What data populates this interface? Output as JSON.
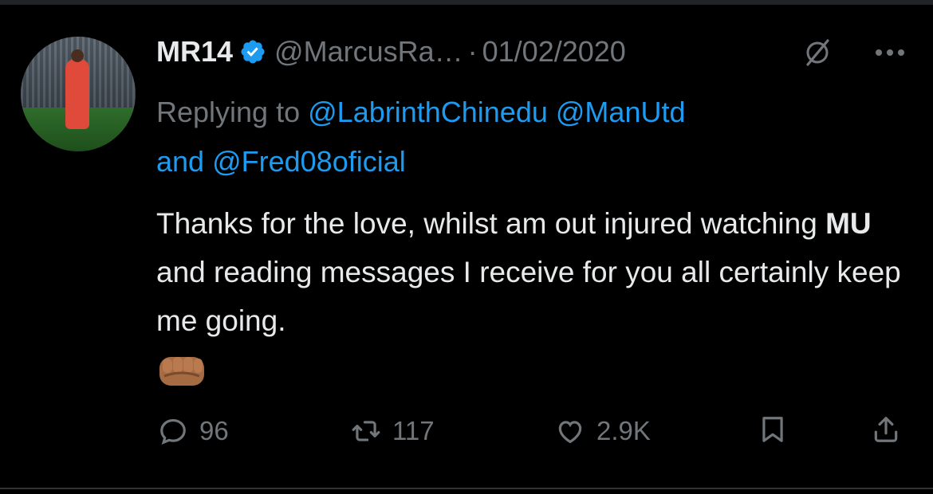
{
  "tweet": {
    "author_name": "MR14",
    "handle": "@MarcusRa…",
    "separator": "·",
    "date": "01/02/2020",
    "replying_prefix": "Replying to",
    "mentions": [
      "@LabrinthChinedu",
      "@ManUtd",
      "@Fred08oficial"
    ],
    "replying_and": "and",
    "body_part1": "Thanks for the love, whilst am out injured watching ",
    "body_bold": "MU",
    "body_part2": " and reading messages I receive for you all certainly keep me going.",
    "emoji_name": "oncoming-fist-medium-dark-skin"
  },
  "actions": {
    "replies": "96",
    "retweets": "117",
    "likes": "2.9K"
  },
  "icons": [
    "verified-badge-icon",
    "grok-icon",
    "more-icon",
    "reply-icon",
    "retweet-icon",
    "like-icon",
    "bookmark-icon",
    "share-icon"
  ],
  "colors": {
    "background": "#000000",
    "text": "#e7e9ea",
    "muted": "#71767b",
    "accent": "#1d9bf0"
  }
}
